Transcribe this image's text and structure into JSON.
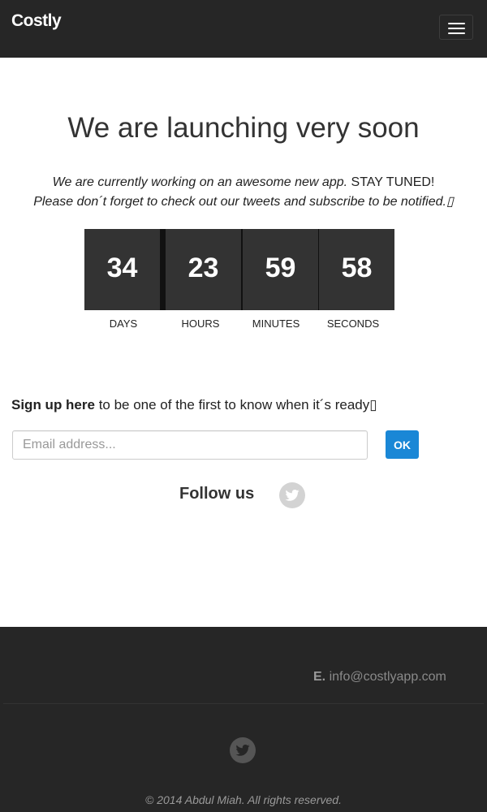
{
  "navbar": {
    "brand": "Costly",
    "menu_icon": "hamburger-menu-icon"
  },
  "hero": {
    "title": "We are launching very soon",
    "intro_line1_italic": "We are currently working on an awesome new app.",
    "intro_line1_normal": " STAY TUNED!",
    "intro_line2": "Please don´t forget to check out our tweets and subscribe to be notified.\u0000"
  },
  "countdown": {
    "days": "34",
    "hours": "23",
    "minutes": "59",
    "seconds": "58",
    "labels": {
      "days": "DAYS",
      "hours": "HOURS",
      "minutes": "MINUTES",
      "seconds": "SECONDS"
    }
  },
  "signup": {
    "bold": "Sign up here",
    "rest": " to be one of the first to know when it´s ready\u0000",
    "email_placeholder": "Email address...",
    "email_value": "",
    "ok_label": "OK"
  },
  "follow": {
    "label": "Follow us",
    "icon": "twitter-icon"
  },
  "footer": {
    "email_prefix": "E.",
    "email": "info@costlyapp.com",
    "icon": "twitter-icon",
    "copyright": "© 2014 Abdul Miah. All rights reserved."
  },
  "colors": {
    "navbar_bg": "#262626",
    "countdown_box": "#333333",
    "button_blue": "#1a87d6",
    "footer_bg": "#262626"
  }
}
